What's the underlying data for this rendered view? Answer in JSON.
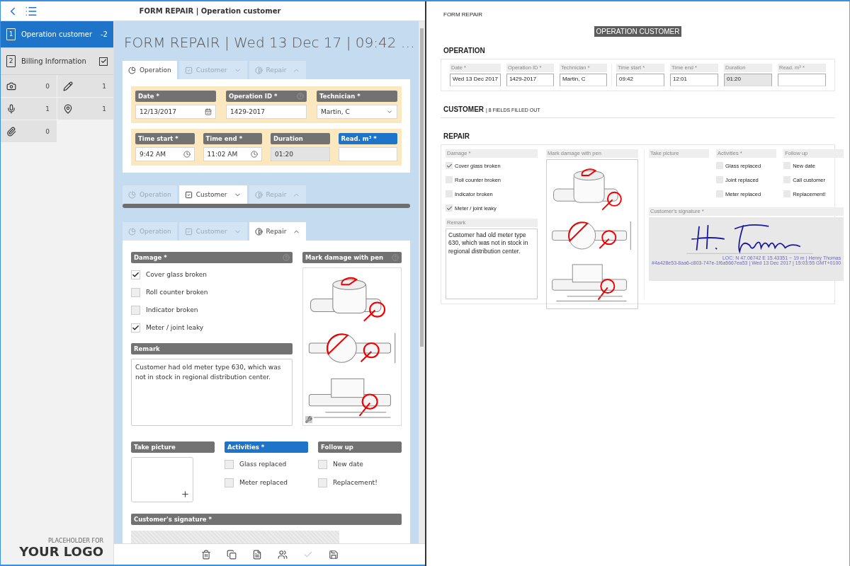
{
  "app_bar": {
    "title": "FORM REPAIR | Operation customer"
  },
  "sidebar": {
    "items": [
      {
        "number": "1",
        "label": "Operation customer",
        "kind": "count",
        "badge": "-2",
        "selected": true
      },
      {
        "number": "2",
        "label": "Billing Information",
        "kind": "check",
        "checked": true,
        "selected": false
      }
    ],
    "counters": [
      {
        "kind": "camera",
        "count": "0"
      },
      {
        "kind": "pen",
        "count": "1"
      },
      {
        "kind": "mic",
        "count": "1"
      },
      {
        "kind": "pin",
        "count": "1"
      },
      {
        "kind": "clip",
        "count": "0"
      }
    ],
    "logo": {
      "caption": "PLACEHOLDER FOR",
      "text": "YOUR LOGO"
    }
  },
  "form": {
    "title": "FORM REPAIR | Wed 13 Dec 17 | 09:42 …",
    "sections": [
      {
        "kind": "operation",
        "tabs": [
          {
            "kind": "pie",
            "label": "Operation",
            "selected": true
          },
          {
            "kind": "check",
            "label": "Customer",
            "selected": false,
            "expanded": false
          },
          {
            "kind": "half",
            "label": "Repair",
            "selected": false,
            "expanded": true
          }
        ],
        "rows": [
          [
            {
              "kind": "date",
              "label": "Date *",
              "value": "12/13/2017"
            },
            {
              "kind": "text",
              "label": "Operation ID *",
              "value": "1429-2017",
              "help": true
            },
            {
              "kind": "select",
              "label": "Technician *",
              "value": "Martin, C"
            }
          ],
          [
            {
              "kind": "time",
              "label": "Time start *",
              "value": "9:42 AM"
            },
            {
              "kind": "time",
              "label": "Time end *",
              "value": "11:02 AM"
            },
            {
              "kind": "readonly",
              "label": "Duration",
              "value": "01:20"
            },
            {
              "kind": "text",
              "label": "Read. m³ *",
              "highlighted": true
            }
          ]
        ]
      },
      {
        "kind": "collapsed",
        "tabs": [
          {
            "kind": "pie",
            "label": "Operation",
            "selected": false
          },
          {
            "kind": "check",
            "label": "Customer",
            "selected": true,
            "expanded": false
          },
          {
            "kind": "half",
            "label": "Repair",
            "selected": false,
            "expanded": true
          }
        ]
      },
      {
        "kind": "repair",
        "tabs": [
          {
            "kind": "pie",
            "label": "Operation",
            "selected": false
          },
          {
            "kind": "check",
            "label": "Customer",
            "selected": false,
            "expanded": false
          },
          {
            "kind": "half",
            "label": "Repair",
            "selected": true,
            "expanded": true
          }
        ],
        "damage": {
          "label": "Damage *",
          "help": true,
          "options": [
            {
              "label": "Cover glass broken",
              "checked": true
            },
            {
              "label": "Roll counter broken",
              "checked": false
            },
            {
              "label": "Indicator broken",
              "checked": false
            },
            {
              "label": "Meter / joint leaky",
              "checked": true
            }
          ]
        },
        "remark": {
          "label": "Remark",
          "value": "Customer had old meter type 630, which was not in stock in regional distribution center."
        },
        "mark": {
          "label": "Mark damage with pen",
          "help": true
        },
        "picture": {
          "label": "Take picture"
        },
        "activities": {
          "label": "Activities *",
          "highlighted": true,
          "options": [
            {
              "label": "Glass replaced",
              "checked": false
            },
            {
              "label": "Meter replaced",
              "checked": false
            }
          ]
        },
        "follow_up": {
          "label": "Follow up",
          "options": [
            {
              "label": "New date",
              "checked": false
            },
            {
              "label": "Replacement!",
              "checked": false
            }
          ]
        },
        "signature": {
          "label": "Customer's signature *"
        }
      }
    ]
  },
  "toolbar": [
    {
      "kind": "delete",
      "disabled": false
    },
    {
      "kind": "copy",
      "disabled": false
    },
    {
      "kind": "pdf",
      "disabled": false
    },
    {
      "kind": "group",
      "disabled": false
    },
    {
      "kind": "check",
      "disabled": true
    },
    {
      "kind": "save",
      "disabled": false
    }
  ],
  "preview": {
    "form_name": "FORM REPAIR",
    "title": "OPERATION CUSTOMER",
    "operation": {
      "heading": "OPERATION",
      "groups": [
        [
          {
            "label": "Date *",
            "value": "Wed 13 Dec 2017"
          },
          {
            "label": "Operation ID *",
            "value": "1429-2017"
          },
          {
            "label": "Technician *",
            "value": "Martin, C"
          }
        ],
        [
          {
            "label": "Time start *",
            "value": "09:42"
          },
          {
            "label": "Time end *",
            "value": "12:01"
          },
          {
            "label": "Duration",
            "value": "01:20",
            "readonly": true
          },
          {
            "label": "Read. m³ *"
          }
        ]
      ]
    },
    "customer": {
      "heading": "CUSTOMER",
      "note": "| 8 FIELDS FILLED OUT"
    },
    "repair": {
      "heading": "REPAIR",
      "damage": {
        "label": "Damage *",
        "options": [
          {
            "label": "Cover glass broken",
            "checked": true
          },
          {
            "label": "Roll counter broken",
            "checked": false
          },
          {
            "label": "Indicator broken",
            "checked": false
          },
          {
            "label": "Meter / joint leaky",
            "checked": true
          }
        ]
      },
      "remark": {
        "label": "Remark",
        "value": "Customer had old meter type 630, which was not in stock in regional distribution center."
      },
      "mark": {
        "label": "Mark damage with pen"
      },
      "picture": {
        "label": "Take picture"
      },
      "activities": {
        "label": "Activities *",
        "options": [
          {
            "label": "Glass replaced",
            "checked": false
          },
          {
            "label": "Joint replaced",
            "checked": false
          },
          {
            "label": "Meter replaced",
            "checked": false
          }
        ]
      },
      "follow_up": {
        "label": "Follow up",
        "options": [
          {
            "label": "New date",
            "checked": false
          },
          {
            "label": "Call customer",
            "checked": false
          },
          {
            "label": "Replacement!",
            "checked": false
          }
        ]
      },
      "signature": {
        "label": "Customer's signature *",
        "location": "LOC: N 47.06742  E 15.43351  ~ 19 m | Henry Thomas",
        "stamp": "#4a428e53-8aa6-c803-747e-1f6a5667ea53 | Wed 13 Dec 2017 | 15:03:55 GMT+0100"
      }
    }
  }
}
